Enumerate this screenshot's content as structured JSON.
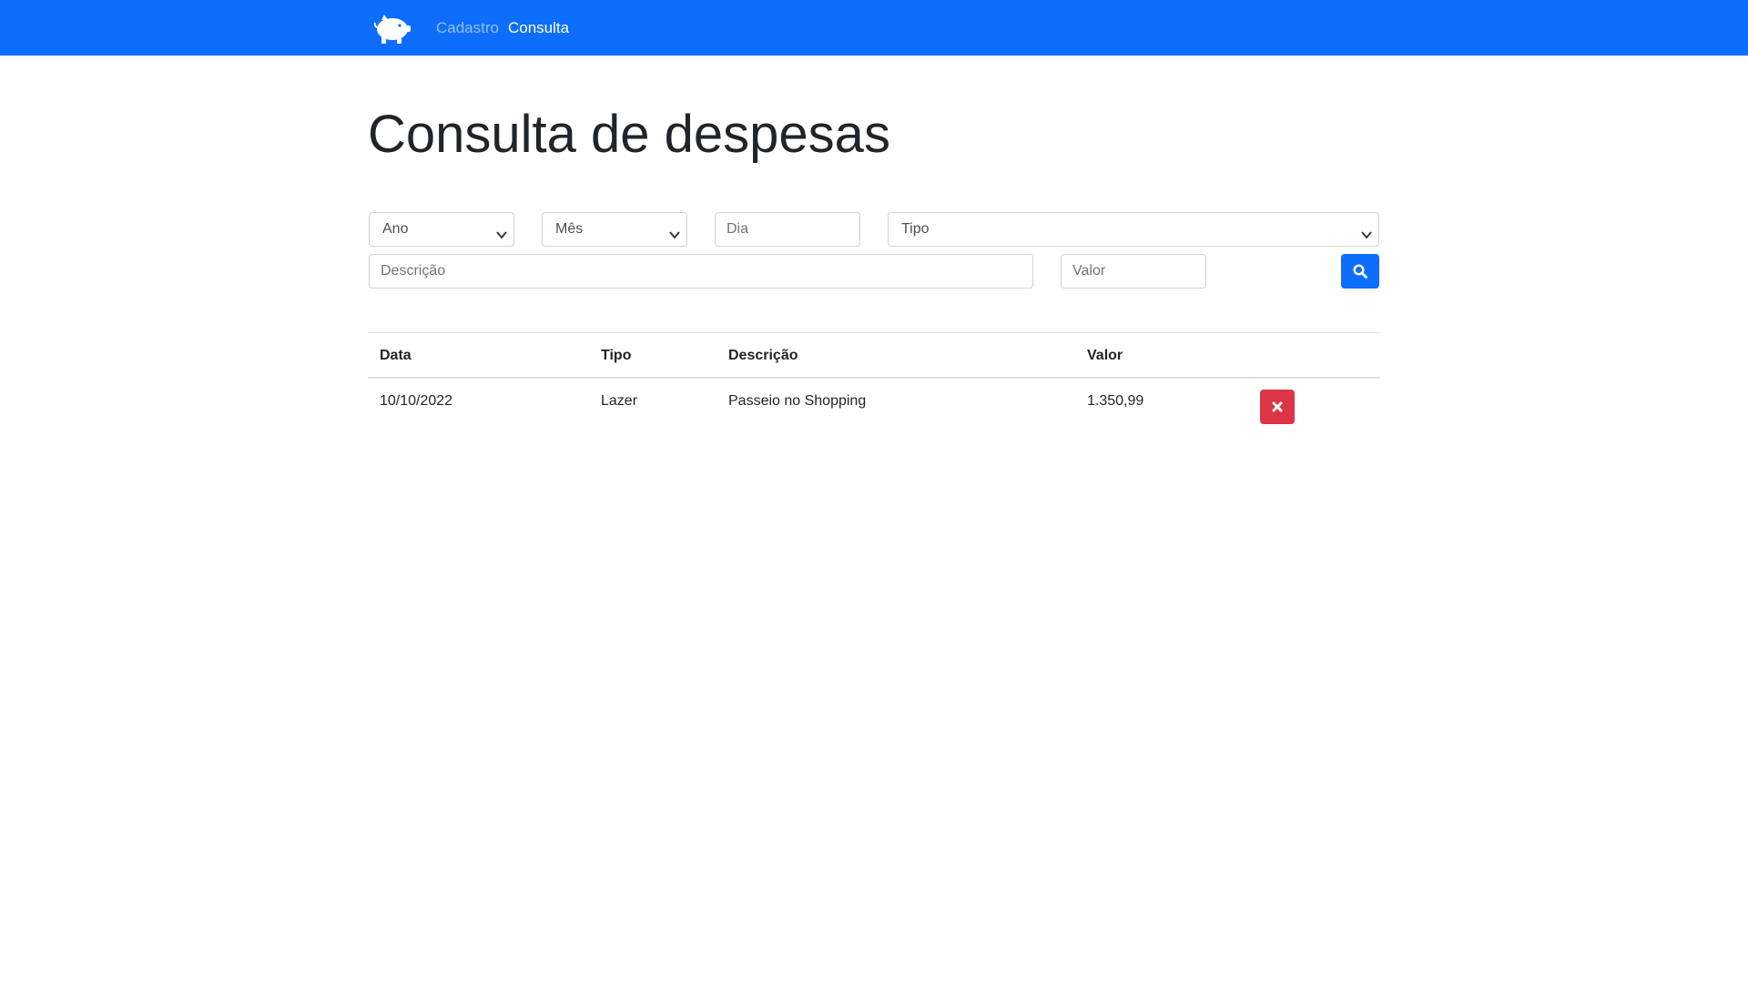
{
  "navbar": {
    "brand_icon": "piggy-bank-icon",
    "links": [
      {
        "label": "Cadastro",
        "active": false
      },
      {
        "label": "Consulta",
        "active": true
      }
    ],
    "background_color": "#0d6efd"
  },
  "page": {
    "title": "Consulta de despesas"
  },
  "filters": {
    "ano": {
      "selected": "Ano"
    },
    "mes": {
      "selected": "Mês"
    },
    "dia": {
      "placeholder": "Dia",
      "value": ""
    },
    "tipo": {
      "selected": "Tipo"
    },
    "descricao": {
      "placeholder": "Descrição",
      "value": ""
    },
    "valor": {
      "placeholder": "Valor",
      "value": ""
    },
    "search_button_icon": "search-icon"
  },
  "table": {
    "headers": {
      "data": "Data",
      "tipo": "Tipo",
      "descricao": "Descrição",
      "valor": "Valor"
    },
    "rows": [
      {
        "data": "10/10/2022",
        "tipo": "Lazer",
        "descricao": "Passeio no Shopping",
        "valor": "1.350,99",
        "action_icon": "close-icon"
      }
    ]
  },
  "colors": {
    "primary": "#0d6efd",
    "danger": "#dc3545",
    "border": "#dee2e6"
  }
}
